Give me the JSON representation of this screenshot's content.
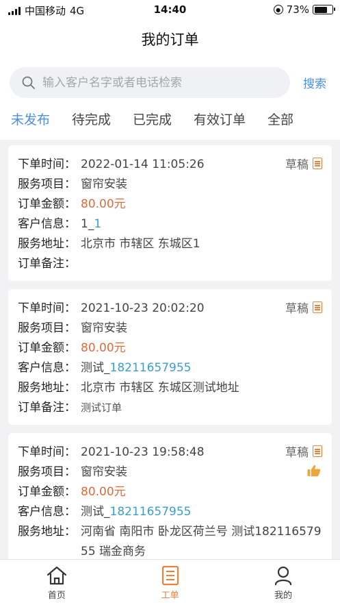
{
  "statusbar": {
    "carrier": "中国移动",
    "network": "4G",
    "time": "14:40",
    "battery": "73%",
    "battery_level": 0.73
  },
  "header": {
    "title": "我的订单"
  },
  "search": {
    "placeholder": "输入客户名字或者电话检索",
    "value": "",
    "button_label": "搜索"
  },
  "tabs": [
    {
      "label": "未发布",
      "active": true
    },
    {
      "label": "待完成",
      "active": false
    },
    {
      "label": "已完成",
      "active": false
    },
    {
      "label": "有效订单",
      "active": false
    },
    {
      "label": "全部",
      "active": false
    }
  ],
  "labels": {
    "order_time": "下单时间：",
    "service": "服务项目：",
    "amount": "订单金额：",
    "customer": "客户信息：",
    "address": "服务地址：",
    "note": "订单备注："
  },
  "orders": [
    {
      "status": "草稿",
      "order_time": "2022-01-14 11:05:26",
      "service": "窗帘安装",
      "amount": "80.00元",
      "customer_name": "1_",
      "customer_phone": "1",
      "address": "北京市 市辖区 东城区1",
      "note": ""
    },
    {
      "status": "草稿",
      "order_time": "2021-10-23 20:02:20",
      "service": "窗帘安装",
      "amount": "80.00元",
      "customer_name": "测试_",
      "customer_phone": "18211657955",
      "address": "北京市 市辖区 东城区测试地址",
      "note": "测试订单"
    },
    {
      "status": "草稿",
      "order_time": "2021-10-23 19:58:48",
      "service": "窗帘安装",
      "amount": "80.00元",
      "customer_name": "测试_",
      "customer_phone": "18211657955",
      "address": "河南省 南阳市 卧龙区荷兰号 测试18211657955 瑞金商务",
      "note": "",
      "has_thumb": true
    }
  ],
  "bottomnav": [
    {
      "label": "首页",
      "icon": "home-icon",
      "active": false
    },
    {
      "label": "工单",
      "icon": "list-icon",
      "active": true
    },
    {
      "label": "我的",
      "icon": "user-icon",
      "active": false
    }
  ],
  "colors": {
    "accent": "#4a90e2",
    "money": "#e06a3b",
    "status_icon": "#e8813a",
    "phone": "#3b9ecc"
  }
}
